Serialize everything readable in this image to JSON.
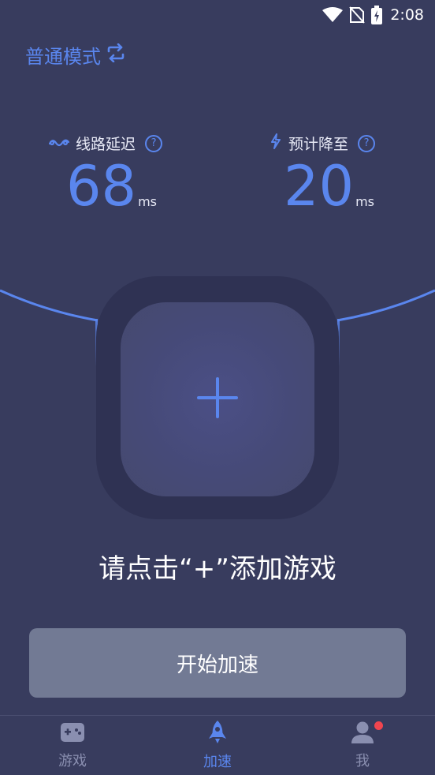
{
  "status_bar": {
    "time": "2:08"
  },
  "mode": {
    "label": "普通模式",
    "switch_icon": "switch-arrows-icon"
  },
  "stats": {
    "latency": {
      "label": "线路延迟",
      "value": "68",
      "unit": "ms",
      "icon": "wave-icon",
      "help_icon": "question-icon"
    },
    "expected": {
      "label": "预计降至",
      "value": "20",
      "unit": "ms",
      "icon": "lightning-icon",
      "help_icon": "question-icon"
    }
  },
  "add_game": {
    "icon": "plus-icon",
    "prompt": "请点击“+”添加游戏"
  },
  "start_button": {
    "label": "开始加速"
  },
  "tabs": [
    {
      "label": "游戏",
      "icon": "gamepad-icon",
      "active": false
    },
    {
      "label": "加速",
      "icon": "rocket-icon",
      "active": true
    },
    {
      "label": "我",
      "icon": "user-icon",
      "active": false,
      "badge": true
    }
  ],
  "colors": {
    "accent": "#5a86ee",
    "background": "#383c5e",
    "button": "#727a94",
    "badge": "#f0454f"
  }
}
